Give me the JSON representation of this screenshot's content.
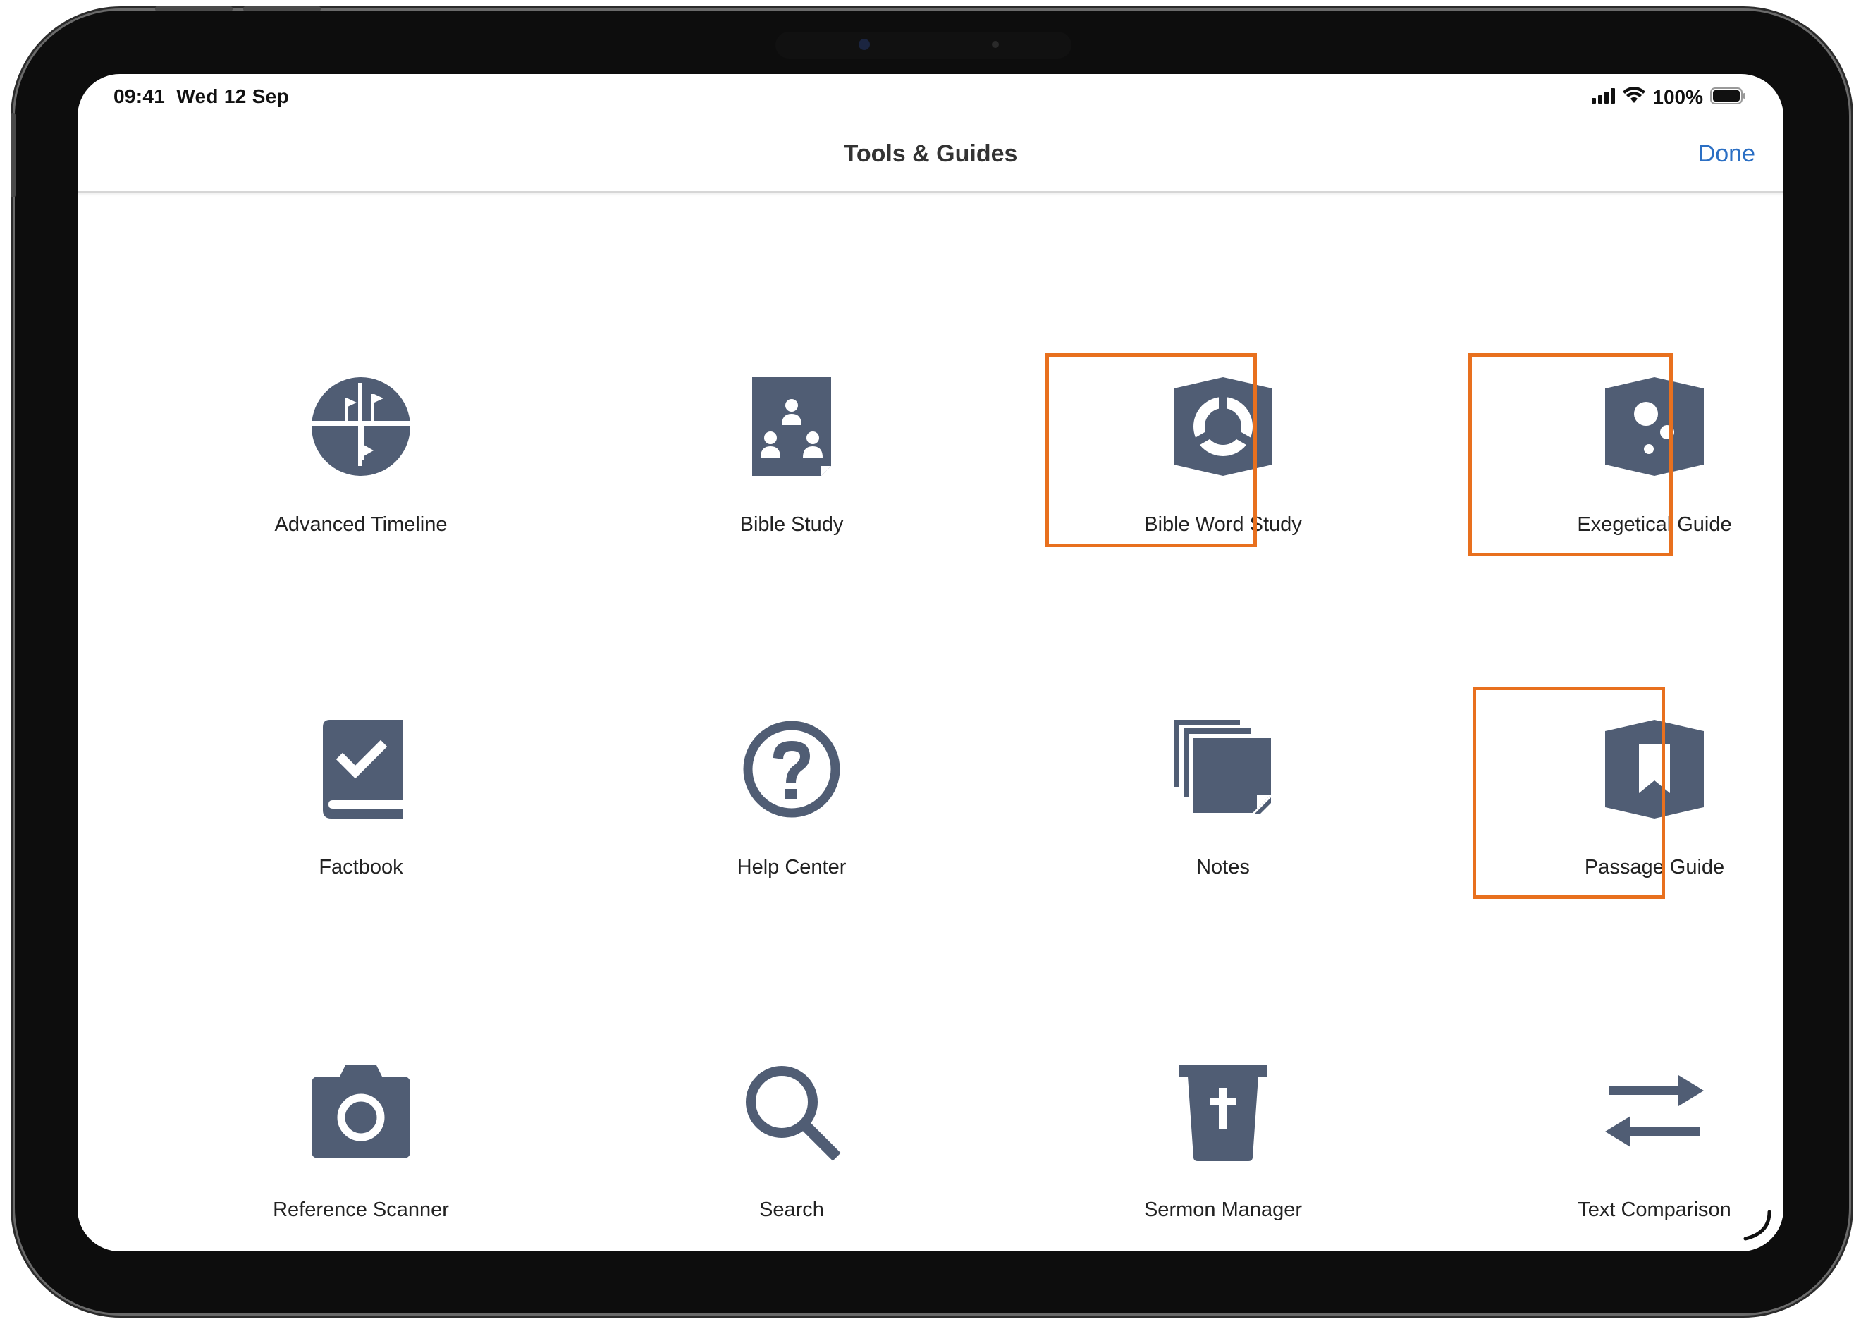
{
  "status_bar": {
    "time": "09:41",
    "date": "Wed 12 Sep",
    "battery": "100%"
  },
  "nav": {
    "title": "Tools & Guides",
    "done_label": "Done"
  },
  "colors": {
    "icon": "#505d74",
    "accent": "#2b6fc4",
    "highlight": "#e8701e"
  },
  "tools": [
    {
      "label": "Advanced Timeline",
      "icon": "timeline-icon",
      "highlighted": false
    },
    {
      "label": "Bible Study",
      "icon": "bible-study-icon",
      "highlighted": false
    },
    {
      "label": "Bible Word Study",
      "icon": "word-study-icon",
      "highlighted": true
    },
    {
      "label": "Exegetical Guide",
      "icon": "exegetical-guide-icon",
      "highlighted": true
    },
    {
      "label": "Factbook",
      "icon": "factbook-icon",
      "highlighted": false
    },
    {
      "label": "Help Center",
      "icon": "help-icon",
      "highlighted": false
    },
    {
      "label": "Notes",
      "icon": "notes-icon",
      "highlighted": false
    },
    {
      "label": "Passage Guide",
      "icon": "passage-guide-icon",
      "highlighted": true
    },
    {
      "label": "Reference Scanner",
      "icon": "camera-icon",
      "highlighted": false
    },
    {
      "label": "Search",
      "icon": "search-icon",
      "highlighted": false
    },
    {
      "label": "Sermon Manager",
      "icon": "sermon-manager-icon",
      "highlighted": false
    },
    {
      "label": "Text Comparison",
      "icon": "text-comparison-icon",
      "highlighted": false
    }
  ]
}
